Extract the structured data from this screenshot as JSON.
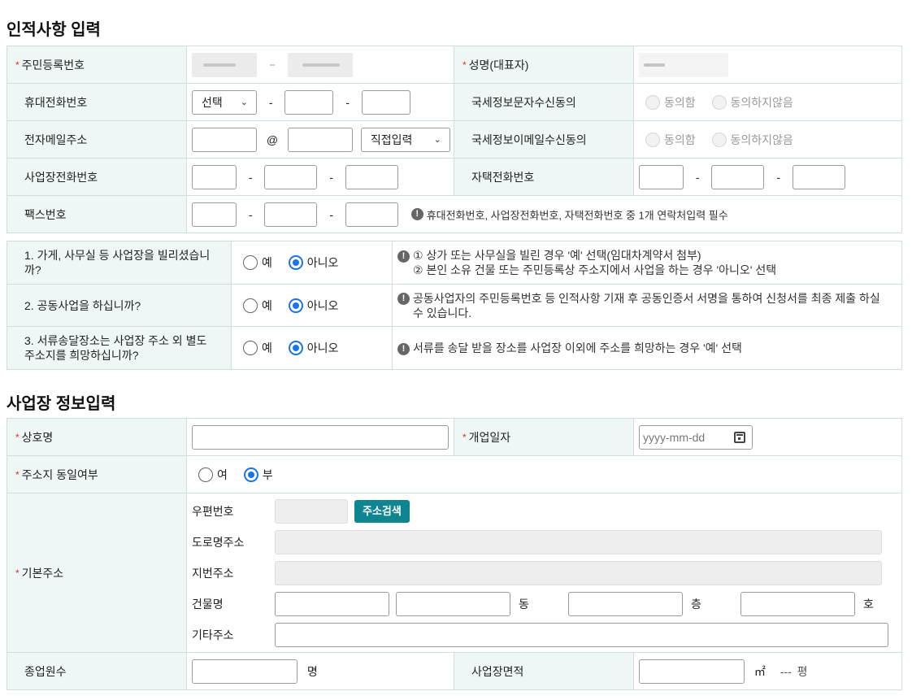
{
  "personal": {
    "title": "인적사항 입력",
    "resident_no_label": "주민등록번호",
    "rep_name_label": "성명(대표자)",
    "mobile_label": "휴대전화번호",
    "mobile_select": "선택",
    "sms_consent_label": "국세정보문자수신동의",
    "email_label": "전자메일주소",
    "email_at": "@",
    "email_domain_select": "직접입력",
    "email_consent_label": "국세정보이메일수신동의",
    "consent_yes": "동의함",
    "consent_no": "동의하지않음",
    "biz_phone_label": "사업장전화번호",
    "home_phone_label": "자택전화번호",
    "fax_label": "팩스번호",
    "contact_notice": "휴대전화번호, 사업장전화번호, 자택전화번호 중 1개 연락처입력 필수",
    "dash": "-"
  },
  "questions": {
    "yes": "예",
    "no": "아니오",
    "items": [
      {
        "text": "1. 가게, 사무실 등 사업장을 빌리셨습니까?",
        "selected": "아니오",
        "hint_line1": "① 상가 또는 사무실을 빌린 경우 '예' 선택(임대차계약서 첨부)",
        "hint_line2": "② 본인 소유 건물 또는 주민등록상 주소지에서 사업을 하는 경우 '아니오' 선택"
      },
      {
        "text": "2. 공동사업을 하십니까?",
        "selected": "아니오",
        "hint_line1": "공동사업자의 주민등록번호 등 인적사항 기재 후 공동인증서 서명을 통하여 신청서를 최종 제출 하실 수 있습니다."
      },
      {
        "text": "3. 서류송달장소는 사업장 주소 외 별도 주소지를 희망하십니까?",
        "selected": "아니오",
        "hint_line1": "서류를 송달 받을 장소를 사업장 이외에 주소를 희망하는 경우 '예' 선택"
      }
    ]
  },
  "business": {
    "title": "사업장 정보입력",
    "trade_name_label": "상호명",
    "open_date_label": "개업일자",
    "open_date_placeholder": "yyyy-mm-dd",
    "same_address_label": "주소지 동일여부",
    "same_yes": "여",
    "same_no": "부",
    "same_selected": "부",
    "basic_address_label": "기본주소",
    "postal_label": "우편번호",
    "address_search_button": "주소검색",
    "road_address_label": "도로명주소",
    "lot_address_label": "지번주소",
    "building_label": "건물명",
    "dong_unit": "동",
    "floor_unit": "층",
    "ho_unit": "호",
    "etc_address_label": "기타주소",
    "employees_label": "종업원수",
    "employees_unit": "명",
    "area_label": "사업장면적",
    "area_unit": "㎡",
    "pyeong_value": "---",
    "pyeong_unit": "평"
  },
  "colors": {
    "label_bg": "#eef7f6",
    "border": "#cfdede",
    "required_star": "#e0302a",
    "radio_selected": "#1a73e8",
    "search_button": "#0f8592"
  }
}
